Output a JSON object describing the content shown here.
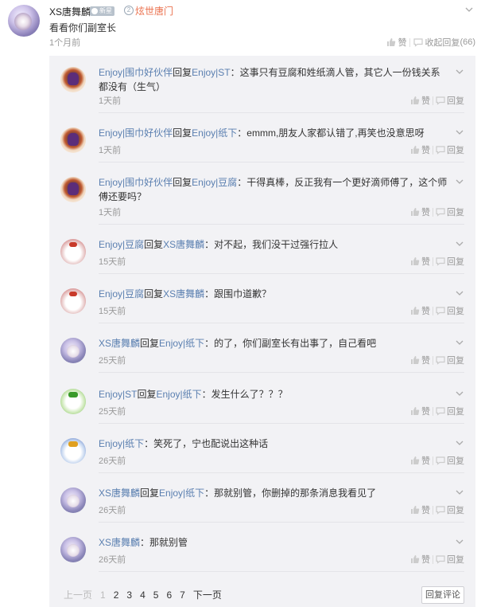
{
  "post": {
    "username": "XS唐舞麟",
    "new_badge": "新星",
    "level": "2",
    "team": "炫世唐门",
    "text": "看看你们副室长",
    "time": "1个月前",
    "like_label": "赞",
    "fold_reply_label": "收起回复",
    "reply_count": "(66)"
  },
  "reply_actions": {
    "like": "赞",
    "reply": "回复"
  },
  "replies": [
    {
      "author": "Enjoy|围巾好伙伴",
      "connector": "回复",
      "target": "Enjoy|ST",
      "text": "：这事只有豆腐和姓纸滴人管，其它人一份钱关系都没有（生气）",
      "time": "1天前",
      "avatar": "red-hat-avatar"
    },
    {
      "author": "Enjoy|围巾好伙伴",
      "connector": "回复",
      "target": "Enjoy|纸下",
      "text": "：emmm,朋友人家都认错了,再笑也没意思呀",
      "time": "1天前",
      "avatar": "red-hat-avatar"
    },
    {
      "author": "Enjoy|围巾好伙伴",
      "connector": "回复",
      "target": "Enjoy|豆腐",
      "text": "：干得真棒，反正我有一个更好滴师傅了，这个师傅还要吗？",
      "time": "1天前",
      "avatar": "red-hat-avatar"
    },
    {
      "author": "Enjoy|豆腐",
      "connector": "回复",
      "target": "XS唐舞麟",
      "text": "：对不起，我们没干过强行拉人",
      "time": "15天前",
      "avatar": "ghost-avatar"
    },
    {
      "author": "Enjoy|豆腐",
      "connector": "回复",
      "target": "XS唐舞麟",
      "text": "：跟围巾道歉？",
      "time": "15天前",
      "avatar": "ghost-avatar"
    },
    {
      "author": "XS唐舞麟",
      "connector": "回复",
      "target": "Enjoy|纸下",
      "text": "：的了，你们副室长有出事了，自己看吧",
      "time": "25天前",
      "avatar": "girl-avatar"
    },
    {
      "author": "Enjoy|ST",
      "connector": "回复",
      "target": "Enjoy|纸下",
      "text": "：发生什么了？？？",
      "time": "25天前",
      "avatar": "green-avatar"
    },
    {
      "author": "Enjoy|纸下",
      "connector": "",
      "target": "",
      "text": "：笑死了，宁也配说出这种话",
      "time": "26天前",
      "avatar": "blue-avatar"
    },
    {
      "author": "XS唐舞麟",
      "connector": "回复",
      "target": "Enjoy|纸下",
      "text": "：那就别管，你删掉的那条消息我看见了",
      "time": "26天前",
      "avatar": "girl-avatar"
    },
    {
      "author": "XS唐舞麟",
      "connector": "",
      "target": "",
      "text": "：那就别管",
      "time": "26天前",
      "avatar": "girl-avatar"
    }
  ],
  "pagination": {
    "prev": "上一页",
    "pages": [
      "1",
      "2",
      "3",
      "4",
      "5",
      "6",
      "7"
    ],
    "current": "1",
    "next": "下一页"
  },
  "reply_comment_button": "回复评论",
  "colors": {
    "username": "#5a7fb0",
    "team_tag": "#eb7350",
    "muted": "#999999",
    "reply_bg": "#f2f2f5"
  }
}
